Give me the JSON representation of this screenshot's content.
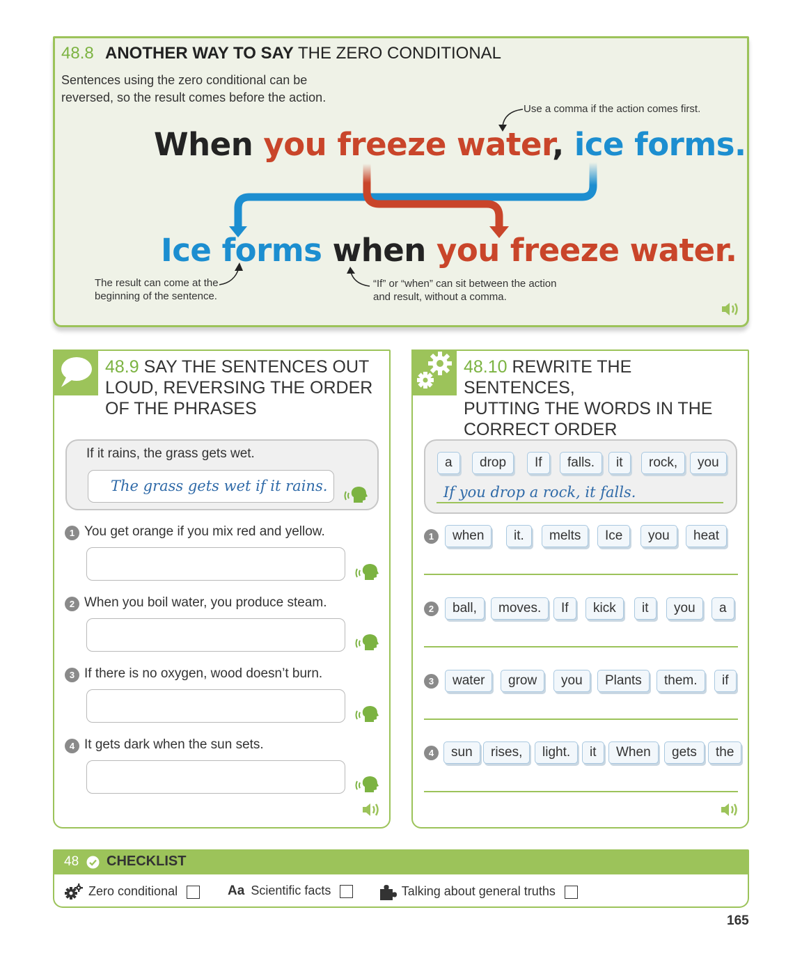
{
  "sec48_8": {
    "number": "48.8",
    "title_bold": "ANOTHER WAY TO SAY",
    "title_rest": "THE ZERO CONDITIONAL",
    "intro": "Sentences using the zero conditional can be reversed, so the result comes before the action.",
    "note_comma": "Use a comma if the action comes first.",
    "sentence1": {
      "w1": "When",
      "w2": "you freeze water",
      "w3": ",",
      "w4": "ice forms."
    },
    "sentence2": {
      "w1": "Ice forms",
      "w2": "when",
      "w3": "you freeze water."
    },
    "note_result": "The result can come at the beginning of the sentence.",
    "note_ifwhen": "“If” or “when” can sit between the action and result, without a comma.",
    "colors": {
      "action": "#c9452a",
      "result": "#1c8ed0",
      "accent": "#9cc35a"
    },
    "speaker_icon": "speaker-icon"
  },
  "sec48_9": {
    "number": "48.9",
    "title": "SAY THE SENTENCES OUT LOUD, REVERSING THE ORDER OF THE PHRASES",
    "title_lines": [
      "SAY THE SENTENCES OUT",
      "LOUD, REVERSING THE ORDER",
      "OF THE PHRASES"
    ],
    "example": {
      "prompt": "If it rains, the grass gets wet.",
      "answer": "The grass gets wet if it rains."
    },
    "questions": [
      {
        "n": "1",
        "text": "You get orange if you mix red and yellow."
      },
      {
        "n": "2",
        "text": "When you boil water, you produce steam."
      },
      {
        "n": "3",
        "text": "If there is no oxygen, wood doesn’t burn."
      },
      {
        "n": "4",
        "text": "It gets dark when the sun sets."
      }
    ],
    "icon": "speech-bubble-icon"
  },
  "sec48_10": {
    "number": "48.10",
    "title": "REWRITE THE SENTENCES, PUTTING THE WORDS IN THE CORRECT ORDER",
    "title_lines": [
      "REWRITE THE SENTENCES,",
      "PUTTING THE WORDS IN THE",
      "CORRECT ORDER"
    ],
    "example": {
      "tiles": [
        "a",
        "drop",
        "If",
        "falls.",
        "it",
        "rock,",
        "you"
      ],
      "answer": "If you drop a rock, it falls."
    },
    "questions": [
      {
        "n": "1",
        "tiles": [
          "when",
          "it.",
          "melts",
          "Ice",
          "you",
          "heat"
        ]
      },
      {
        "n": "2",
        "tiles": [
          "ball,",
          "moves.",
          "If",
          "kick",
          "it",
          "you",
          "a"
        ]
      },
      {
        "n": "3",
        "tiles": [
          "water",
          "grow",
          "you",
          "Plants",
          "them.",
          "if"
        ]
      },
      {
        "n": "4",
        "tiles": [
          "sun",
          "rises,",
          "light.",
          "it",
          "When",
          "gets",
          "the"
        ]
      }
    ],
    "icon": "gears-icon"
  },
  "checklist": {
    "number": "48",
    "title": "CHECKLIST",
    "items": [
      {
        "label": "Zero conditional",
        "icon": "gear-icon"
      },
      {
        "label": "Scientific facts",
        "icon_text": "Aa",
        "icon": "vocabulary-icon"
      },
      {
        "label": "Talking about general truths",
        "icon": "puzzle-icon"
      }
    ]
  },
  "page_number": "165"
}
